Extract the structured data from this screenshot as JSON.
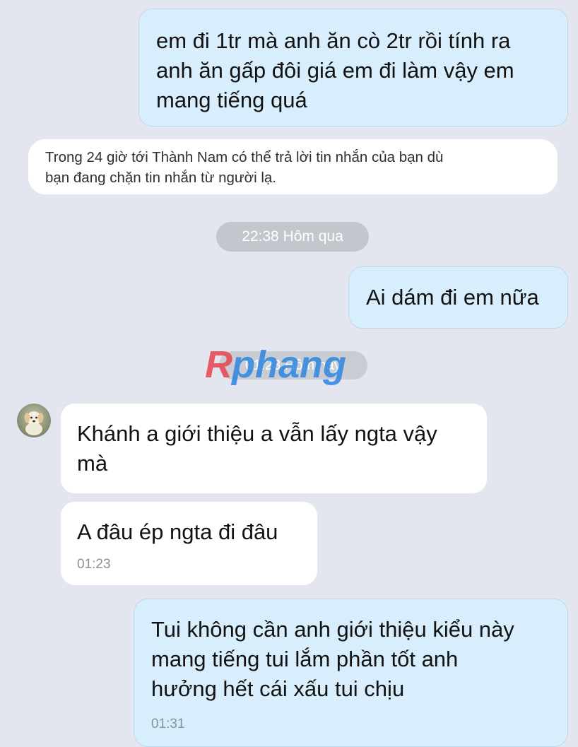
{
  "messages": {
    "m1": {
      "text": "em đi 1tr mà anh ăn cò 2tr rồi tính ra\nanh ăn gấp đôi giá em đi làm vậy em\nmang tiếng quá"
    },
    "notice": {
      "text": "Trong 24 giờ tới Thành Nam có thể trả lời tin nhắn của bạn dù\nbạn đang chặn tin nhắn từ người lạ."
    },
    "date1": "22:38 Hôm qua",
    "m2": {
      "text": "Ai dám đi em nữa"
    },
    "date2": "01:23 Hôm nay",
    "watermark": "Rphang",
    "m3": {
      "text": "Khánh a giới thiệu a vẫn lấy ngta vậy\nmà"
    },
    "m4": {
      "text": "A đâu ép ngta đi đâu",
      "time": "01:23"
    },
    "m5": {
      "text": "Tui không cần anh giới thiệu kiểu này\nmang tiếng tui lắm phần tốt anh\nhưởng hết cái xấu tui chịu",
      "time": "01:31"
    }
  },
  "colors": {
    "background": "#e3e6ef",
    "outgoing_bubble": "#d9eefc",
    "incoming_bubble": "#ffffff",
    "watermark_red": "#e8434d",
    "watermark_blue": "#2e86e0"
  },
  "icons": {
    "avatar": "puppy-avatar"
  }
}
